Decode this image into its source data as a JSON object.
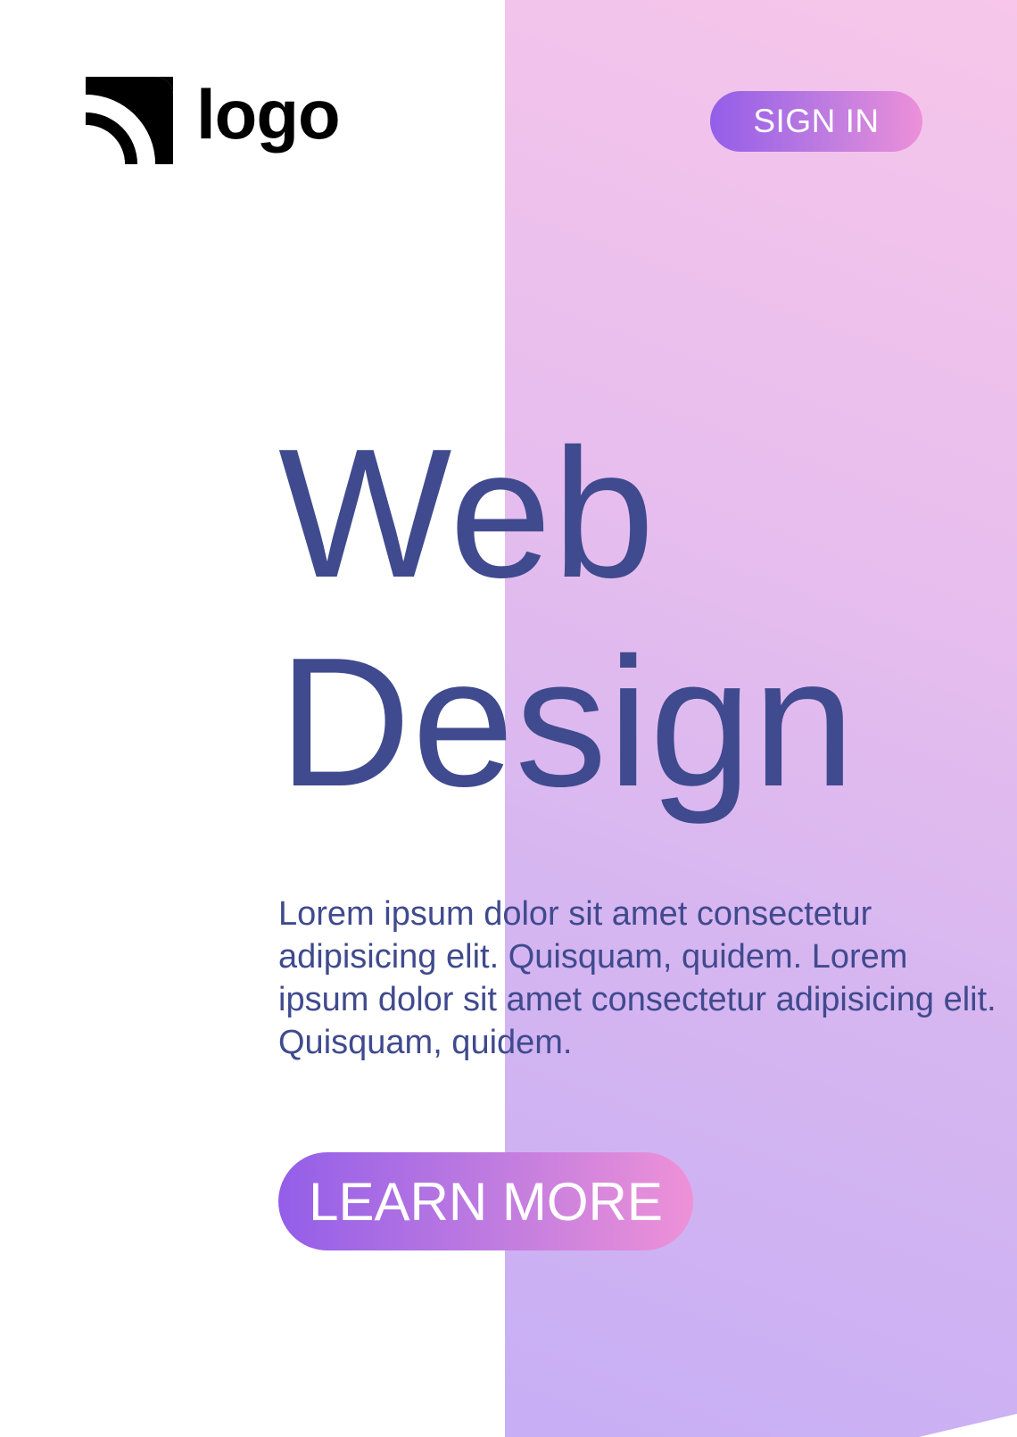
{
  "header": {
    "logo_text": "logo",
    "logo_icon": "signal-arcs-icon",
    "signin_label": "SIGN IN"
  },
  "hero": {
    "title_line1": "Web",
    "title_line2": "Design",
    "description": "Lorem ipsum dolor sit amet consectetur adipisicing elit. Quisquam, quidem. Lorem ipsum dolor sit amet consectetur adipisicing elit. Quisquam, quidem.",
    "cta_label": "LEARN MORE"
  },
  "colors": {
    "heading": "#404a8e",
    "button_gradient_start": "#935ee8",
    "button_gradient_end": "#ee91d8",
    "panel_top": "#f7c6ea",
    "panel_bottom": "#c7aef5"
  }
}
